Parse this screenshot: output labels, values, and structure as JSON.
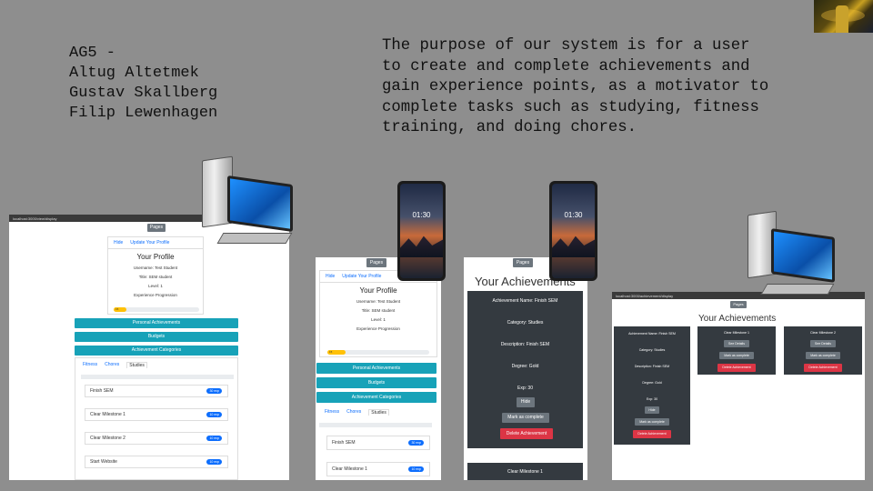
{
  "team": {
    "lines": [
      "AG5 -",
      "Altug Altetmek",
      "Gustav Skallberg",
      "Filip Lewenhagen"
    ]
  },
  "purpose": {
    "lines": [
      "The purpose of our system is for a user",
      "to create and complete achievements and",
      "gain experience points, as a motivator to",
      "complete tasks such as studying, fitness",
      "training, and doing chores."
    ]
  },
  "icons": {
    "avatar": "game-avatar-icon",
    "computer": "desktop-computer-icon",
    "phone": "smartphone-icon"
  },
  "phone": {
    "clock": "01:30"
  },
  "colors": {
    "teal": "#17a2b8",
    "dark_card": "#343a40",
    "danger": "#dc3545",
    "secondary": "#6c757d",
    "progress": "#ffc107"
  },
  "profile_view": {
    "url": "localhost:3000/view/display",
    "pages_label": "Pages",
    "tabs": [
      "Hide",
      "Update Your Profile"
    ],
    "title": "Your Profile",
    "username": "Username: Test Student",
    "title_line": "Title: SEM student",
    "level": "Level: 1",
    "experience_label": "Experience Progression",
    "progress_value": 0.15,
    "progress_text": "15",
    "bars": [
      "Personal Achievements",
      "Budgets",
      "Achievement Categories"
    ],
    "categories": [
      "Fitness",
      "Chores",
      "Studies"
    ],
    "tasks": [
      {
        "name": "Finish SEM",
        "badge": "30 exp"
      },
      {
        "name": "Clear Milestone 1",
        "badge": "10 exp"
      },
      {
        "name": "Clear Milestone 2",
        "badge": "10 exp"
      },
      {
        "name": "Start Website",
        "badge": "10 exp"
      }
    ]
  },
  "mobile_profile": {
    "pages_label": "Pages",
    "tabs": [
      "Hide",
      "Update Your Profile"
    ],
    "title": "Your Profile",
    "username": "Username: Test Student",
    "title_line": "Title: SEM student",
    "level": "Level: 1",
    "experience_label": "Experience Progression",
    "progress_value": 0.18,
    "progress_text": "15",
    "bars": [
      "Personal Achievements",
      "Budgets",
      "Achievement Categories"
    ],
    "categories": [
      "Fitness",
      "Chores",
      "Studies"
    ],
    "tasks": [
      {
        "name": "Finish SEM",
        "badge": "30 exp"
      },
      {
        "name": "Clear Milestone 1",
        "badge": "10 exp"
      }
    ]
  },
  "mobile_achievements": {
    "pages_label": "Pages",
    "heading": "Your Achievements",
    "name": "Achievement Name: Finish SEM",
    "category": "Category: Studies",
    "description": "Description: Finish SEM",
    "degree": "Degree: Gold",
    "exp": "Exp: 30",
    "hide": "Hide",
    "mark": "Mark as complete",
    "delete": "Delete Achievement",
    "next_card": "Clear Milestone 1"
  },
  "desktop_achievements": {
    "url": "localhost:3000/achievement/display",
    "pages_label": "Pages",
    "heading": "Your Achievements",
    "main": {
      "name": "Achievement Name: Finish SEM",
      "category": "Category: Studies",
      "description": "Description: Finish SEM",
      "degree": "Degree: Gold",
      "exp": "Exp: 30",
      "hide": "Hide",
      "mark": "Mark as complete",
      "delete": "Delete Achievement"
    },
    "col2": {
      "title": "Clear Milestone 1",
      "see": "See Details",
      "mark": "Mark as complete",
      "delete": "Delete Achievement"
    },
    "col3": {
      "title": "Clear Milestone 2",
      "see": "See Details",
      "mark": "Mark as complete",
      "delete": "Delete Achievement"
    }
  }
}
